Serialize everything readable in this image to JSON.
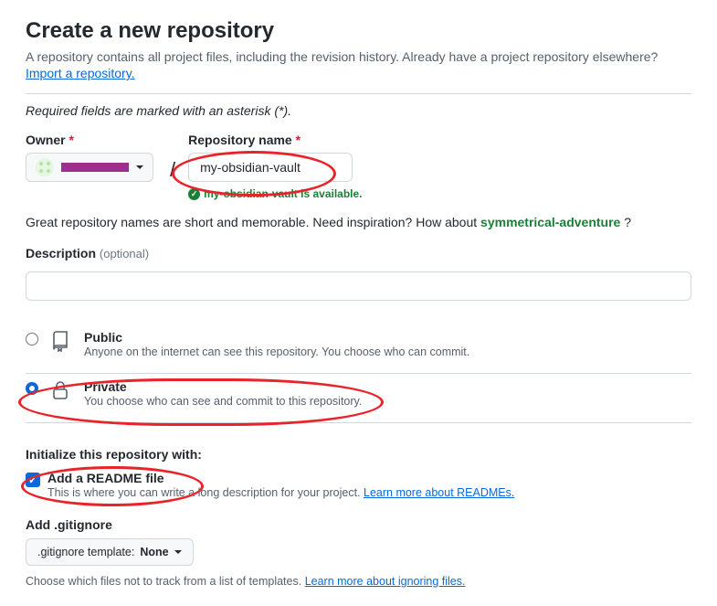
{
  "header": {
    "title": "Create a new repository",
    "subtitle": "A repository contains all project files, including the revision history. Already have a project repository elsewhere?",
    "import_link": "Import a repository.",
    "required_note": "Required fields are marked with an asterisk (*)."
  },
  "owner": {
    "label": "Owner",
    "asterisk": "*"
  },
  "repo_name": {
    "label": "Repository name",
    "asterisk": "*",
    "value": "my-obsidian-vault",
    "availability_msg": "my-obsidian-vault is available."
  },
  "inspiration": {
    "prefix": "Great repository names are short and memorable. Need inspiration? How about ",
    "suggestion": "symmetrical-adventure",
    "suffix": " ?"
  },
  "description": {
    "label": "Description",
    "optional": "(optional)",
    "value": ""
  },
  "visibility": {
    "public": {
      "title": "Public",
      "desc": "Anyone on the internet can see this repository. You choose who can commit."
    },
    "private": {
      "title": "Private",
      "desc": "You choose who can see and commit to this repository."
    }
  },
  "init": {
    "heading": "Initialize this repository with:",
    "readme": {
      "label": "Add a README file",
      "desc_prefix": "This is where you can write a long description for your project. ",
      "learn_link": "Learn more about READMEs."
    }
  },
  "gitignore": {
    "label": "Add .gitignore",
    "button_prefix": ".gitignore template: ",
    "button_value": "None",
    "desc_prefix": "Choose which files not to track from a list of templates. ",
    "learn_link": "Learn more about ignoring files."
  }
}
